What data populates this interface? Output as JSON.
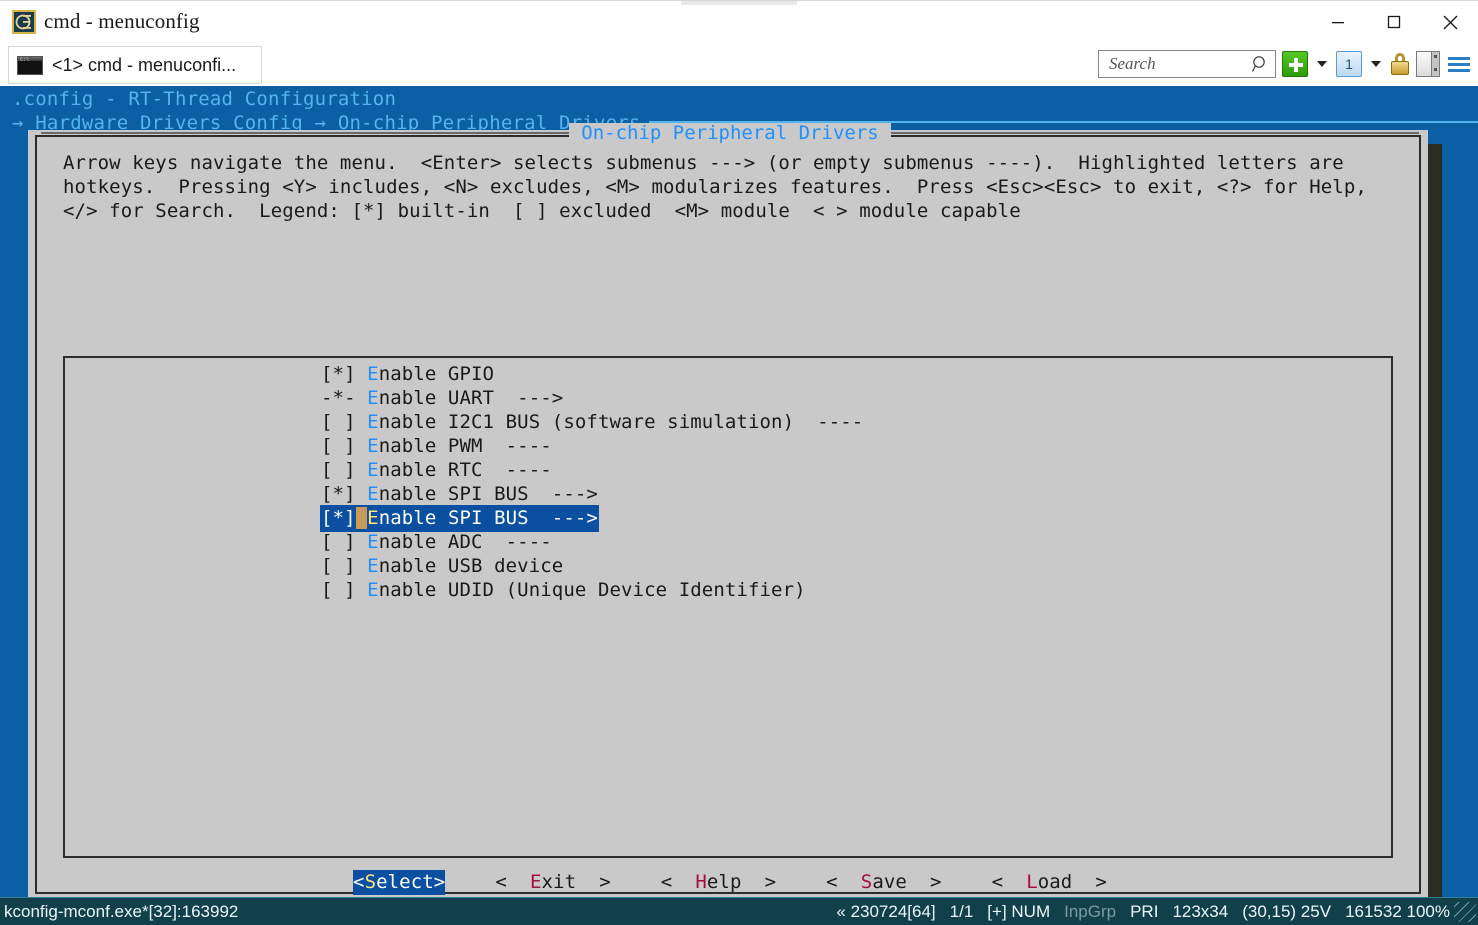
{
  "window": {
    "title": "cmd - menuconfig",
    "icon": "console-emblem-icon",
    "minimize_label": "minimize-icon",
    "maximize_label": "maximize-icon",
    "close_label": "close-icon"
  },
  "tabstrip": {
    "tabs": [
      {
        "label": "<1> cmd - menuconfi...",
        "icon": "console-window-icon",
        "active": true
      }
    ]
  },
  "toolbar": {
    "search": {
      "placeholder": "Search",
      "value": "",
      "icon": "magnifier-icon"
    },
    "new_tab": {
      "label": "+",
      "icon": "green-plus-icon"
    },
    "new_tab_caret": {
      "icon": "chevron-down-icon"
    },
    "tab_number": {
      "label": "1",
      "icon": "tab-number-icon"
    },
    "tab_caret": {
      "icon": "chevron-down-icon"
    },
    "lock": {
      "icon": "padlock-icon"
    },
    "panel": {
      "icon": "split-panel-icon"
    },
    "menu": {
      "icon": "hamburger-menu-icon"
    }
  },
  "console": {
    "header_line": ".config - RT-Thread Configuration",
    "breadcrumb": "→ Hardware Drivers Config → On-chip Peripheral Drivers"
  },
  "dialog": {
    "frame_title": "On-chip Peripheral Drivers",
    "help_text": "Arrow keys navigate the menu.  <Enter> selects submenus ---> (or empty submenus ----).  Highlighted letters are\nhotkeys.  Pressing <Y> includes, <N> excludes, <M> modularizes features.  Press <Esc><Esc> to exit, <?> for Help,\n</> for Search.  Legend: [*] built-in  [ ] excluded  <M> module  < > module capable",
    "items": [
      {
        "mark": "[*]",
        "hotkey": "E",
        "rest": "nable GPIO",
        "selected": false
      },
      {
        "mark": "-*-",
        "hotkey": "E",
        "rest": "nable UART  --->",
        "selected": false
      },
      {
        "mark": "[ ]",
        "hotkey": "E",
        "rest": "nable I2C1 BUS (software simulation)  ----",
        "selected": false
      },
      {
        "mark": "[ ]",
        "hotkey": "E",
        "rest": "nable PWM  ----",
        "selected": false
      },
      {
        "mark": "[ ]",
        "hotkey": "E",
        "rest": "nable RTC  ----",
        "selected": false
      },
      {
        "mark": "[*]",
        "hotkey": "E",
        "rest": "nable SPI BUS  --->",
        "selected": false
      },
      {
        "mark": "[*]",
        "hotkey": "E",
        "rest": "nable SPI BUS  --->",
        "selected": true
      },
      {
        "mark": "[ ]",
        "hotkey": "E",
        "rest": "nable ADC  ----",
        "selected": false
      },
      {
        "mark": "[ ]",
        "hotkey": "E",
        "rest": "nable USB device",
        "selected": false
      },
      {
        "mark": "[ ]",
        "hotkey": "E",
        "rest": "nable UDID (Unique Device Identifier)",
        "selected": false
      }
    ],
    "buttons": [
      {
        "prefix": "<",
        "hotkey": "S",
        "rest": "elect>",
        "selected": true
      },
      {
        "prefix": "<  ",
        "hotkey": "E",
        "rest": "xit  >",
        "selected": false
      },
      {
        "prefix": "<  ",
        "hotkey": "H",
        "rest": "elp  >",
        "selected": false
      },
      {
        "prefix": "<  ",
        "hotkey": "S",
        "rest": "ave  >",
        "selected": false
      },
      {
        "prefix": "<  ",
        "hotkey": "L",
        "rest": "oad  >",
        "selected": false
      }
    ]
  },
  "statusbar": {
    "left": "kconfig-mconf.exe*[32]:163992",
    "right": {
      "codepage": "« 230724[64]",
      "pages": "1/1",
      "insert": "[+] NUM",
      "input_group": "InpGrp",
      "priority": "PRI",
      "size": "123x34",
      "cursor": "(30,15) 25V",
      "memory": "161532 100%"
    }
  },
  "colors": {
    "console_bg": "#0b5fa5",
    "console_fg": "#53b4f0",
    "dialog_bg": "#c9c9c9",
    "dialog_fg": "#1a1a1a",
    "hotkey_blue": "#1e90ff",
    "hotkey_red": "#a80c3c",
    "selection_bg": "#0a4fa0",
    "selection_fg": "#ffffff",
    "cursor_block": "#c79a5a",
    "shadow": "#2b2b26",
    "statusbar_bg": "#11404a"
  }
}
